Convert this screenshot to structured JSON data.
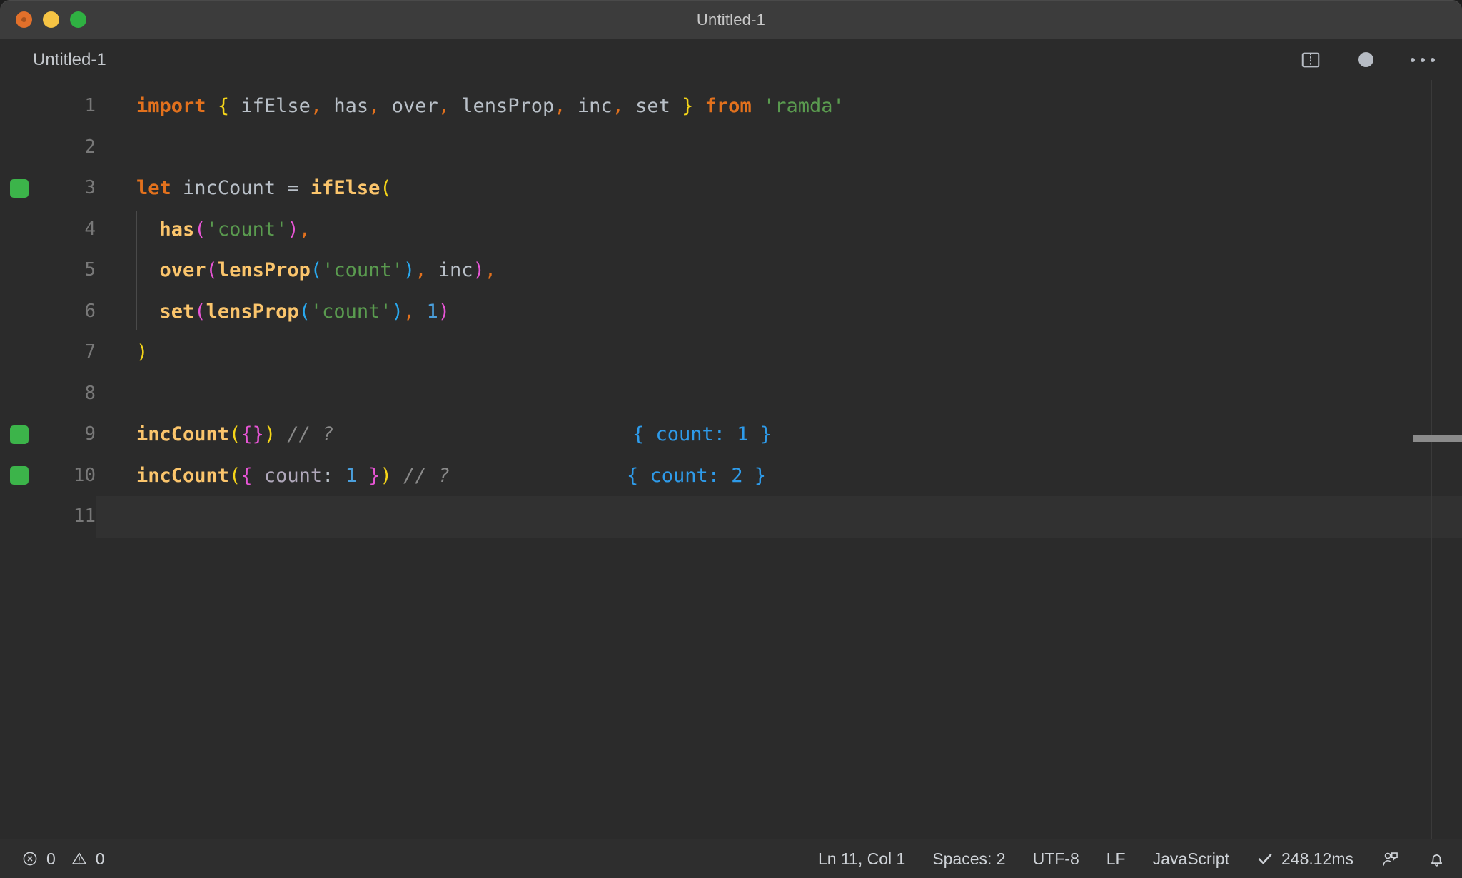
{
  "window": {
    "title": "Untitled-1",
    "traffic_lights": [
      {
        "name": "close",
        "color": "#e2702a"
      },
      {
        "name": "minimize",
        "color": "#f6c444"
      },
      {
        "name": "maximize",
        "color": "#2fb142"
      }
    ]
  },
  "tabbar": {
    "tab_label": "Untitled-1",
    "split_editor_icon": "split-editor-icon",
    "unsaved_dot_icon": "unsaved-dot-icon",
    "more_actions_icon": "ellipsis-icon"
  },
  "editor": {
    "language": "JavaScript",
    "lines": [
      {
        "number": "1",
        "marker": false,
        "current": false,
        "tokens": [
          {
            "t": "import",
            "c": "kw"
          },
          {
            "t": " ",
            "c": "plain"
          },
          {
            "t": "{",
            "c": "br1"
          },
          {
            "t": " ifElse",
            "c": "plain"
          },
          {
            "t": ",",
            "c": "op"
          },
          {
            "t": " has",
            "c": "plain"
          },
          {
            "t": ",",
            "c": "op"
          },
          {
            "t": " over",
            "c": "plain"
          },
          {
            "t": ",",
            "c": "op"
          },
          {
            "t": " lensProp",
            "c": "plain"
          },
          {
            "t": ",",
            "c": "op"
          },
          {
            "t": " inc",
            "c": "plain"
          },
          {
            "t": ",",
            "c": "op"
          },
          {
            "t": " set ",
            "c": "plain"
          },
          {
            "t": "}",
            "c": "br1"
          },
          {
            "t": " ",
            "c": "plain"
          },
          {
            "t": "from",
            "c": "kw"
          },
          {
            "t": " ",
            "c": "plain"
          },
          {
            "t": "'ramda'",
            "c": "str"
          }
        ]
      },
      {
        "number": "2",
        "marker": false,
        "current": false,
        "tokens": []
      },
      {
        "number": "3",
        "marker": true,
        "current": false,
        "tokens": [
          {
            "t": "let",
            "c": "kw"
          },
          {
            "t": " incCount ",
            "c": "plain"
          },
          {
            "t": "=",
            "c": "plain"
          },
          {
            "t": " ",
            "c": "plain"
          },
          {
            "t": "ifElse",
            "c": "fn"
          },
          {
            "t": "(",
            "c": "br1"
          }
        ]
      },
      {
        "number": "4",
        "marker": false,
        "current": false,
        "tokens": [
          {
            "t": "  ",
            "c": "plain"
          },
          {
            "t": "has",
            "c": "fn"
          },
          {
            "t": "(",
            "c": "br2"
          },
          {
            "t": "'count'",
            "c": "str"
          },
          {
            "t": ")",
            "c": "br2"
          },
          {
            "t": ",",
            "c": "op"
          }
        ]
      },
      {
        "number": "5",
        "marker": false,
        "current": false,
        "tokens": [
          {
            "t": "  ",
            "c": "plain"
          },
          {
            "t": "over",
            "c": "fn"
          },
          {
            "t": "(",
            "c": "br2"
          },
          {
            "t": "lensProp",
            "c": "fn"
          },
          {
            "t": "(",
            "c": "br3"
          },
          {
            "t": "'count'",
            "c": "str"
          },
          {
            "t": ")",
            "c": "br3"
          },
          {
            "t": ",",
            "c": "op"
          },
          {
            "t": " inc",
            "c": "plain"
          },
          {
            "t": ")",
            "c": "br2"
          },
          {
            "t": ",",
            "c": "op"
          }
        ]
      },
      {
        "number": "6",
        "marker": false,
        "current": false,
        "tokens": [
          {
            "t": "  ",
            "c": "plain"
          },
          {
            "t": "set",
            "c": "fn"
          },
          {
            "t": "(",
            "c": "br2"
          },
          {
            "t": "lensProp",
            "c": "fn"
          },
          {
            "t": "(",
            "c": "br3"
          },
          {
            "t": "'count'",
            "c": "str"
          },
          {
            "t": ")",
            "c": "br3"
          },
          {
            "t": ",",
            "c": "op"
          },
          {
            "t": " ",
            "c": "plain"
          },
          {
            "t": "1",
            "c": "num"
          },
          {
            "t": ")",
            "c": "br2"
          }
        ]
      },
      {
        "number": "7",
        "marker": false,
        "current": false,
        "tokens": [
          {
            "t": ")",
            "c": "br1"
          }
        ]
      },
      {
        "number": "8",
        "marker": false,
        "current": false,
        "tokens": []
      },
      {
        "number": "9",
        "marker": true,
        "current": false,
        "tokens": [
          {
            "t": "incCount",
            "c": "fn"
          },
          {
            "t": "(",
            "c": "br1"
          },
          {
            "t": "{",
            "c": "br2"
          },
          {
            "t": "}",
            "c": "br2"
          },
          {
            "t": ")",
            "c": "br1"
          },
          {
            "t": " ",
            "c": "plain"
          },
          {
            "t": "// ?",
            "c": "comment"
          }
        ],
        "result": "{ count: 1 }"
      },
      {
        "number": "10",
        "marker": true,
        "current": false,
        "tokens": [
          {
            "t": "incCount",
            "c": "fn"
          },
          {
            "t": "(",
            "c": "br1"
          },
          {
            "t": "{",
            "c": "br2"
          },
          {
            "t": " ",
            "c": "plain"
          },
          {
            "t": "count",
            "c": "prop"
          },
          {
            "t": ":",
            "c": "plain"
          },
          {
            "t": " ",
            "c": "plain"
          },
          {
            "t": "1",
            "c": "num"
          },
          {
            "t": " ",
            "c": "plain"
          },
          {
            "t": "}",
            "c": "br2"
          },
          {
            "t": ")",
            "c": "br1"
          },
          {
            "t": " ",
            "c": "plain"
          },
          {
            "t": "// ?",
            "c": "comment"
          }
        ],
        "result": "{ count: 2 }"
      },
      {
        "number": "11",
        "marker": false,
        "current": true,
        "tokens": []
      }
    ]
  },
  "statusbar": {
    "errors_count": "0",
    "warnings_count": "0",
    "cursor_position": "Ln 11, Col 1",
    "indentation": "Spaces: 2",
    "encoding": "UTF-8",
    "eol": "LF",
    "language_mode": "JavaScript",
    "run_time": "248.12ms",
    "run_status_icon": "check-icon",
    "error_icon": "error-circle-icon",
    "warning_icon": "warning-triangle-icon",
    "live_share_icon": "live-share-icon",
    "notifications_icon": "bell-icon"
  },
  "colors": {
    "titlebar_bg": "#3c3c3c",
    "editor_bg": "#2b2b2b",
    "statusbar_bg": "#2e2e2e",
    "gutter_marker_green": "#3cb44a",
    "result_blue": "#2e9bea",
    "keyword_orange": "#e2711d",
    "function_yellow": "#fbc56c",
    "string_green": "#5a9b4f",
    "number_blue": "#4a9fdc"
  }
}
